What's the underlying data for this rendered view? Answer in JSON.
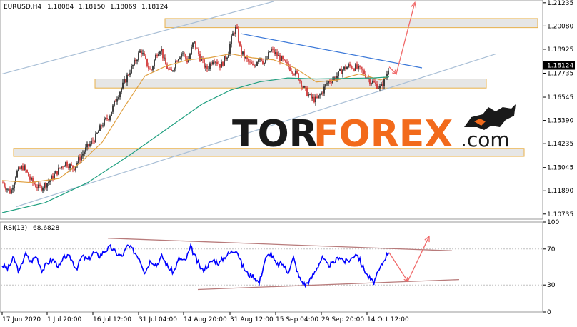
{
  "header": {
    "symbol": "EURUSD,H4",
    "open": "1.18084",
    "high": "1.18150",
    "low": "1.18069",
    "close": "1.18124"
  },
  "rsi_header": {
    "label": "RSI(13)",
    "value": "68.6828"
  },
  "logo": {
    "text_tor": "TOR",
    "text_forex": "FOREX",
    "text_com": ".com",
    "color_dark": "#1a1a1a",
    "color_accent": "#f26a1b"
  },
  "colors": {
    "bull": "#111111",
    "bear": "#cc1f1f",
    "ma_fast": "#e0a040",
    "ma_slow": "#20a080",
    "channel": "#a9bfd6",
    "trendline": "#3b78d8",
    "zone_fill": "#e0e0e0",
    "zone_border": "#e8b04a",
    "arrow": "#f06a6a",
    "rsi_line": "#0000ff",
    "rsi_trend": "#b87b7b"
  },
  "chart_data": [
    {
      "type": "candlestick",
      "symbol": "EURUSD",
      "timeframe": "H4",
      "ylim": [
        1.1055,
        1.213
      ],
      "y_ticks": [
        "1.21235",
        "1.20080",
        "1.18925",
        "1.17735",
        "1.16545",
        "1.15390",
        "1.14235",
        "1.13045",
        "1.11890",
        "1.10735"
      ],
      "current_price": "1.18124",
      "x_ticks": [
        "17 Jun 2020",
        "1 Jul 20:00",
        "16 Jul 12:00",
        "31 Jul 04:00",
        "14 Aug 20:00",
        "31 Aug 12:00",
        "15 Sep 04:00",
        "29 Sep 20:00",
        "14 Oct 12:00"
      ],
      "close_path": [
        [
          0,
          1.123
        ],
        [
          12,
          1.118
        ],
        [
          20,
          1.128
        ],
        [
          30,
          1.131
        ],
        [
          40,
          1.124
        ],
        [
          52,
          1.12
        ],
        [
          64,
          1.123
        ],
        [
          76,
          1.128
        ],
        [
          88,
          1.133
        ],
        [
          100,
          1.13
        ],
        [
          110,
          1.136
        ],
        [
          120,
          1.141
        ],
        [
          130,
          1.145
        ],
        [
          140,
          1.152
        ],
        [
          150,
          1.156
        ],
        [
          160,
          1.165
        ],
        [
          170,
          1.172
        ],
        [
          178,
          1.178
        ],
        [
          186,
          1.183
        ],
        [
          194,
          1.189
        ],
        [
          200,
          1.184
        ],
        [
          208,
          1.178
        ],
        [
          216,
          1.187
        ],
        [
          222,
          1.19
        ],
        [
          228,
          1.182
        ],
        [
          236,
          1.177
        ],
        [
          244,
          1.184
        ],
        [
          252,
          1.188
        ],
        [
          260,
          1.183
        ],
        [
          268,
          1.193
        ],
        [
          276,
          1.186
        ],
        [
          286,
          1.179
        ],
        [
          296,
          1.185
        ],
        [
          306,
          1.181
        ],
        [
          316,
          1.187
        ],
        [
          322,
          1.196
        ],
        [
          328,
          1.2
        ],
        [
          334,
          1.188
        ],
        [
          342,
          1.184
        ],
        [
          352,
          1.18
        ],
        [
          360,
          1.186
        ],
        [
          368,
          1.182
        ],
        [
          376,
          1.189
        ],
        [
          386,
          1.186
        ],
        [
          396,
          1.182
        ],
        [
          406,
          1.179
        ],
        [
          414,
          1.176
        ],
        [
          422,
          1.17
        ],
        [
          432,
          1.165
        ],
        [
          440,
          1.164
        ],
        [
          448,
          1.168
        ],
        [
          456,
          1.173
        ],
        [
          466,
          1.175
        ],
        [
          476,
          1.179
        ],
        [
          486,
          1.181
        ],
        [
          496,
          1.18
        ],
        [
          506,
          1.178
        ],
        [
          514,
          1.174
        ],
        [
          522,
          1.172
        ],
        [
          530,
          1.17
        ],
        [
          538,
          1.176
        ],
        [
          542,
          1.1812
        ]
      ],
      "ma_fast_path": [
        [
          0,
          1.124
        ],
        [
          40,
          1.123
        ],
        [
          80,
          1.125
        ],
        [
          110,
          1.133
        ],
        [
          140,
          1.143
        ],
        [
          170,
          1.16
        ],
        [
          200,
          1.176
        ],
        [
          230,
          1.181
        ],
        [
          260,
          1.184
        ],
        [
          290,
          1.185
        ],
        [
          320,
          1.187
        ],
        [
          350,
          1.185
        ],
        [
          380,
          1.184
        ],
        [
          410,
          1.18
        ],
        [
          440,
          1.173
        ],
        [
          470,
          1.174
        ],
        [
          500,
          1.177
        ],
        [
          530,
          1.174
        ],
        [
          542,
          1.176
        ]
      ],
      "ma_slow_path": [
        [
          0,
          1.108
        ],
        [
          60,
          1.113
        ],
        [
          120,
          1.123
        ],
        [
          180,
          1.137
        ],
        [
          240,
          1.152
        ],
        [
          280,
          1.162
        ],
        [
          320,
          1.169
        ],
        [
          360,
          1.173
        ],
        [
          400,
          1.175
        ],
        [
          440,
          1.1745
        ],
        [
          480,
          1.1748
        ],
        [
          520,
          1.175
        ],
        [
          542,
          1.1755
        ]
      ],
      "channel_upper": [
        [
          0,
          1.177
        ],
        [
          380,
          1.213
        ]
      ],
      "channel_lower": [
        [
          20,
          1.111
        ],
        [
          692,
          1.187
        ]
      ],
      "resistance_line": [
        [
          334,
          1.197
        ],
        [
          588,
          1.18
        ]
      ],
      "zones": [
        {
          "x": [
            228,
            750
          ],
          "y": [
            1.2,
            1.2045
          ]
        },
        {
          "x": [
            130,
            678
          ],
          "y": [
            1.17,
            1.1745
          ]
        },
        {
          "x": [
            16,
            731
          ],
          "y": [
            1.136,
            1.14
          ]
        }
      ],
      "forecast_arrows": [
        {
          "from": [
            542,
            1.1805
          ],
          "via": [
            552,
            1.177
          ],
          "to": [
            578,
            1.2125
          ]
        }
      ]
    },
    {
      "type": "line",
      "name": "RSI(13)",
      "ylim": [
        0,
        100
      ],
      "y_ticks": [
        "100",
        "70",
        "30",
        "0"
      ],
      "values_path": [
        [
          0,
          52
        ],
        [
          8,
          48
        ],
        [
          16,
          60
        ],
        [
          24,
          44
        ],
        [
          32,
          65
        ],
        [
          40,
          56
        ],
        [
          48,
          62
        ],
        [
          56,
          46
        ],
        [
          64,
          55
        ],
        [
          72,
          58
        ],
        [
          80,
          50
        ],
        [
          88,
          62
        ],
        [
          96,
          60
        ],
        [
          104,
          48
        ],
        [
          112,
          62
        ],
        [
          120,
          58
        ],
        [
          128,
          66
        ],
        [
          136,
          62
        ],
        [
          144,
          68
        ],
        [
          152,
          72
        ],
        [
          160,
          65
        ],
        [
          168,
          62
        ],
        [
          176,
          74
        ],
        [
          184,
          68
        ],
        [
          192,
          60
        ],
        [
          200,
          44
        ],
        [
          208,
          58
        ],
        [
          216,
          52
        ],
        [
          224,
          62
        ],
        [
          232,
          50
        ],
        [
          240,
          44
        ],
        [
          248,
          60
        ],
        [
          256,
          56
        ],
        [
          264,
          72
        ],
        [
          272,
          58
        ],
        [
          280,
          46
        ],
        [
          288,
          52
        ],
        [
          296,
          58
        ],
        [
          304,
          54
        ],
        [
          312,
          62
        ],
        [
          320,
          66
        ],
        [
          328,
          70
        ],
        [
          336,
          52
        ],
        [
          344,
          42
        ],
        [
          352,
          40
        ],
        [
          360,
          32
        ],
        [
          368,
          58
        ],
        [
          376,
          66
        ],
        [
          384,
          52
        ],
        [
          392,
          54
        ],
        [
          400,
          44
        ],
        [
          408,
          60
        ],
        [
          416,
          38
        ],
        [
          424,
          30
        ],
        [
          432,
          36
        ],
        [
          440,
          48
        ],
        [
          448,
          60
        ],
        [
          456,
          52
        ],
        [
          464,
          54
        ],
        [
          472,
          62
        ],
        [
          480,
          56
        ],
        [
          488,
          58
        ],
        [
          496,
          66
        ],
        [
          504,
          52
        ],
        [
          512,
          40
        ],
        [
          520,
          32
        ],
        [
          528,
          46
        ],
        [
          536,
          60
        ],
        [
          542,
          68
        ]
      ],
      "trend_upper": [
        [
          148,
          82
        ],
        [
          630,
          68
        ]
      ],
      "trend_lower": [
        [
          274,
          25
        ],
        [
          640,
          36
        ]
      ],
      "forecast_arrows": [
        {
          "from": [
            542,
            66
          ],
          "via": [
            568,
            34
          ],
          "to": [
            598,
            84
          ]
        }
      ]
    }
  ]
}
